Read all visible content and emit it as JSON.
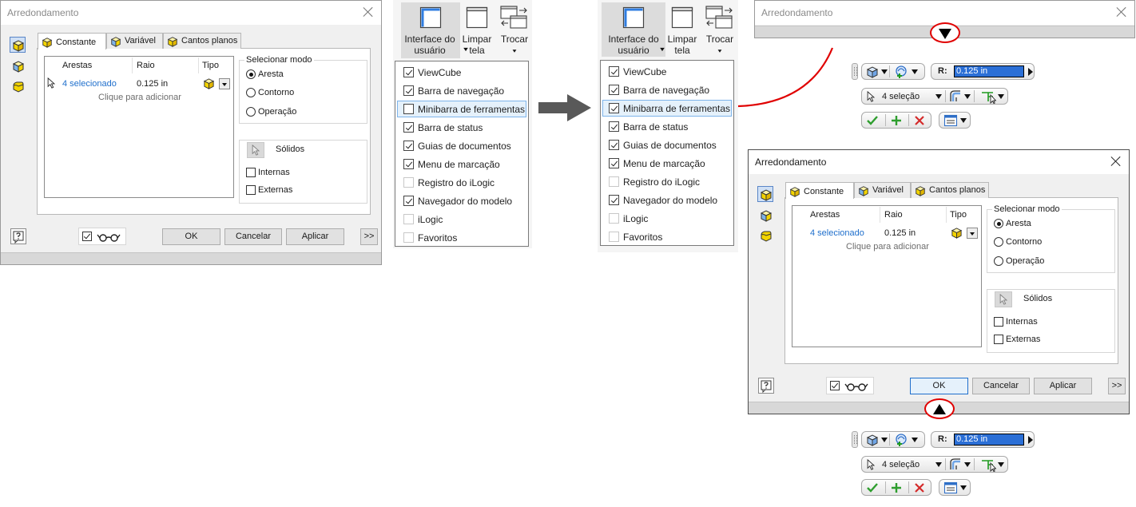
{
  "dialog": {
    "title": "Arredondamento",
    "tabs": [
      {
        "label": "Constante"
      },
      {
        "label": "Variável"
      },
      {
        "label": "Cantos planos"
      }
    ],
    "columns": {
      "edges": "Arestas",
      "radius": "Raio",
      "type": "Tipo"
    },
    "row": {
      "edges": "4 selecionado",
      "radius": "0.125 in"
    },
    "add_hint": "Clique para adicionar",
    "select_mode": {
      "legend": "Selecionar modo",
      "options": [
        "Aresta",
        "Contorno",
        "Operação"
      ],
      "selected": "Aresta"
    },
    "solids": {
      "label": "Sólidos",
      "internal": "Internas",
      "external": "Externas"
    },
    "buttons": {
      "ok": "OK",
      "cancel": "Cancelar",
      "apply": "Aplicar",
      "more": ">>"
    }
  },
  "ribbon": {
    "user_interface": "Interface do usuário",
    "clean_screen": "Limpar tela",
    "switch": "Trocar"
  },
  "menu_before": {
    "items": [
      {
        "label": "ViewCube",
        "checked": true
      },
      {
        "label": "Barra de navegação",
        "checked": true
      },
      {
        "label": "Minibarra de ferramentas",
        "checked": false,
        "highlighted": true
      },
      {
        "label": "Barra de status",
        "checked": true
      },
      {
        "label": "Guias de documentos",
        "checked": true
      },
      {
        "label": "Menu de marcação",
        "checked": true
      },
      {
        "label": "Registro do iLogic",
        "checked": false
      },
      {
        "label": "Navegador do modelo",
        "checked": true
      },
      {
        "label": "iLogic",
        "checked": false
      },
      {
        "label": "Favoritos",
        "checked": false
      }
    ]
  },
  "menu_after": {
    "items": [
      {
        "label": "ViewCube",
        "checked": true
      },
      {
        "label": "Barra de navegação",
        "checked": true
      },
      {
        "label": "Minibarra de ferramentas",
        "checked": true,
        "highlighted": true
      },
      {
        "label": "Barra de status",
        "checked": true
      },
      {
        "label": "Guias de documentos",
        "checked": true
      },
      {
        "label": "Menu de marcação",
        "checked": true
      },
      {
        "label": "Registro do iLogic",
        "checked": false
      },
      {
        "label": "Navegador do modelo",
        "checked": true
      },
      {
        "label": "iLogic",
        "checked": false
      },
      {
        "label": "Favoritos",
        "checked": false
      }
    ]
  },
  "minitoolbar": {
    "radius_label": "R:",
    "radius_value": "0.125 in",
    "selection": "4 seleção"
  },
  "colors": {
    "accent": "#1f6fcc",
    "annotation": "#e00000",
    "arrow": "#595959",
    "ok_green": "#2e9e2e",
    "cancel_red": "#d42a2a"
  },
  "icons": [
    "fillet-edge-icon",
    "fillet-face-icon",
    "fillet-full-round-icon",
    "constant-tab-icon",
    "variable-tab-icon",
    "setback-tab-icon",
    "edge-type-icon",
    "select-cursor-icon",
    "help-icon",
    "preview-check-icon",
    "preview-glasses-icon",
    "user-interface-icon",
    "clean-screen-icon",
    "switch-windows-icon",
    "arrow-right-icon",
    "triangle-down-icon",
    "triangle-up-icon",
    "fillet-type-icon",
    "fillet-mode-icon",
    "edge-select-icon",
    "fillet-smooth-icon",
    "fillet-setback-icon",
    "ok-check-icon",
    "apply-plus-icon",
    "cancel-x-icon",
    "options-icon"
  ]
}
